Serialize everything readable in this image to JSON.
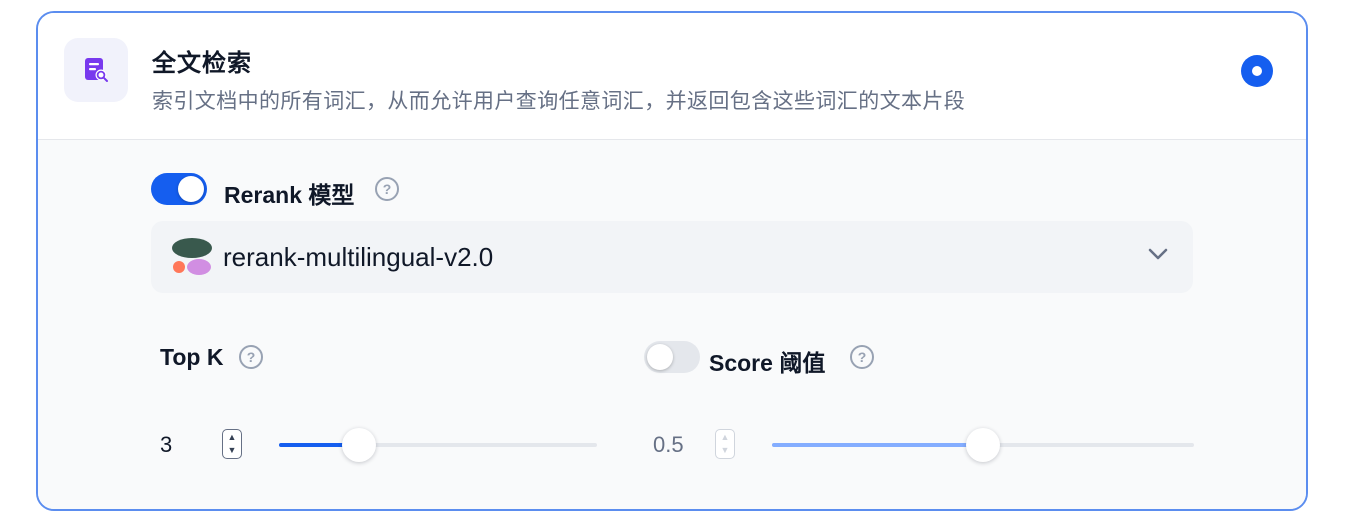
{
  "header": {
    "title": "全文检索",
    "description": "索引文档中的所有词汇，从而允许用户查询任意词汇，并返回包含这些词汇的文本片段",
    "icon": "document-search-icon",
    "selected": true
  },
  "rerank": {
    "enabled": true,
    "label": "Rerank 模型",
    "help": "?",
    "model": {
      "name": "rerank-multilingual-v2.0",
      "icon": "cohere-logo-icon"
    }
  },
  "top_k": {
    "label": "Top K",
    "help": "?",
    "value": "3",
    "slider_fraction": 0.25
  },
  "score_threshold": {
    "enabled": false,
    "label": "Score 阈值",
    "help": "?",
    "value": "0.5",
    "slider_fraction": 0.5
  },
  "colors": {
    "accent": "#155eef",
    "border": "#5b8def"
  }
}
